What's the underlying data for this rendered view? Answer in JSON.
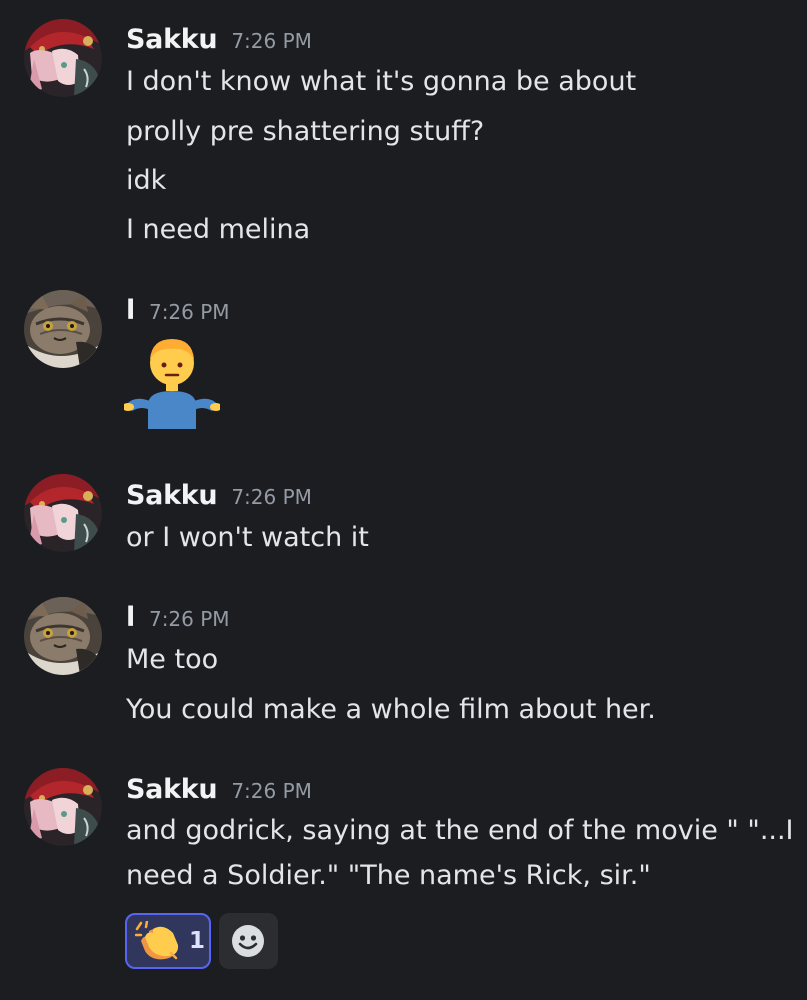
{
  "messages": [
    {
      "username": "Sakku",
      "timestamp": "7:26 PM",
      "lines": [
        "I don't know what it's gonna be about",
        "prolly pre shattering stuff?",
        "idk",
        "I need melina"
      ]
    },
    {
      "username": "l",
      "timestamp": "7:26 PM",
      "emoji": "person-shrugging-emoji"
    },
    {
      "username": "Sakku",
      "timestamp": "7:26 PM",
      "lines": [
        "or I won't watch it"
      ]
    },
    {
      "username": "l",
      "timestamp": "7:26 PM",
      "lines": [
        "Me too",
        "You could make a whole film about her."
      ]
    },
    {
      "username": "Sakku",
      "timestamp": "7:26 PM",
      "lines": [
        "and godrick, saying at the end of the movie \" \"...I",
        "need a Soldier.\" \"The name's Rick, sir.\""
      ],
      "reactions": [
        {
          "icon": "clapping-hands-emoji",
          "count": "1",
          "selected": true
        },
        {
          "icon": "add-reaction-smiley-icon"
        }
      ]
    }
  ],
  "colors": {
    "background": "#1c1d21",
    "username": "#f2f3f5",
    "timestamp": "#949ba4",
    "message_text": "#e3e5e8",
    "reaction_selected_bg": "#30365c",
    "reaction_selected_border": "#5865f2"
  }
}
